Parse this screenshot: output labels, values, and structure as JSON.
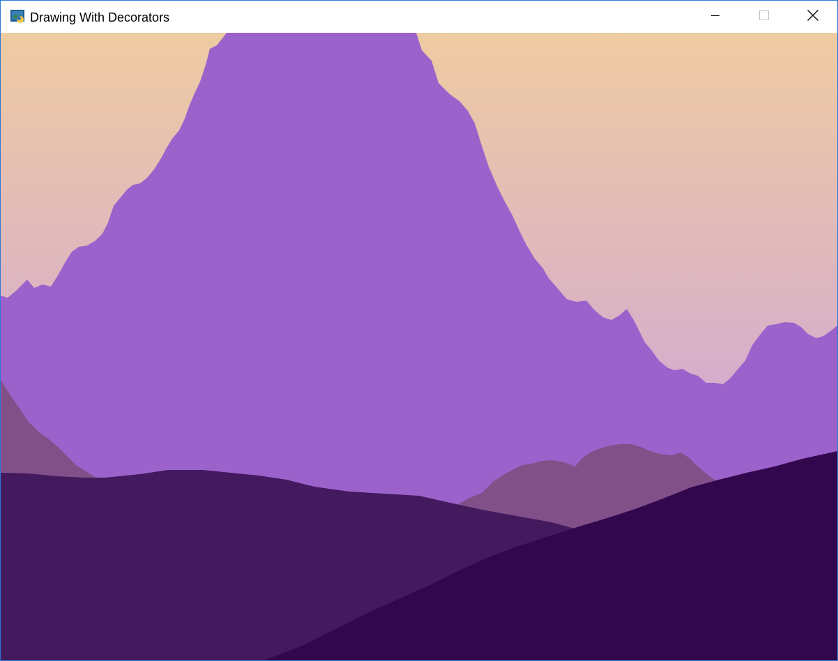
{
  "window": {
    "title": "Drawing With Decorators",
    "icons": {
      "app": "python-app-icon",
      "minimize": "minimize-icon",
      "maximize": "maximize-icon",
      "close": "close-icon"
    }
  },
  "scene": {
    "sky_top_color": "#efcba2",
    "sky_bottom_color": "#d6aecb",
    "mountain_color": "#9c62cc",
    "mid_hill_color": "#825089",
    "near_hill_color": "#441a5f",
    "front_hill_color": "#32074e"
  }
}
